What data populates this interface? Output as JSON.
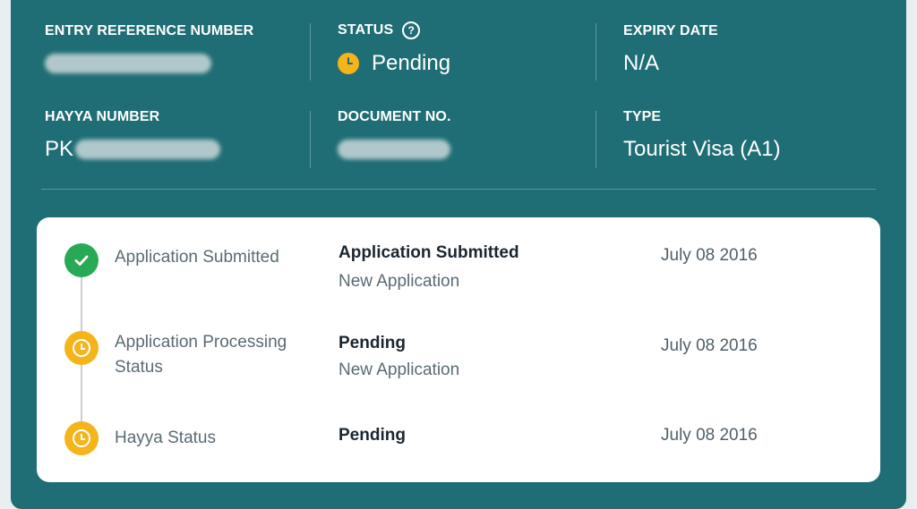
{
  "info": {
    "entry_ref_label": "ENTRY REFERENCE NUMBER",
    "status_label": "STATUS",
    "status_value": "Pending",
    "expiry_label": "EXPIRY DATE",
    "expiry_value": "N/A",
    "hayya_label": "HAYYA NUMBER",
    "hayya_value_prefix": "PK",
    "document_label": "DOCUMENT NO.",
    "type_label": "TYPE",
    "type_value": "Tourist Visa (A1)"
  },
  "timeline": [
    {
      "name": "Application Submitted",
      "status": "Application Submitted",
      "sub": "New Application",
      "date": "July 08 2016",
      "state": "done",
      "icon": "check-icon"
    },
    {
      "name_line1": "Application Processing",
      "name_line2": "Status",
      "status": "Pending",
      "sub": "New Application",
      "date": "July 08 2016",
      "state": "pending",
      "icon": "clock-icon"
    },
    {
      "name": "Hayya Status",
      "status": "Pending",
      "date": "July 08 2016",
      "state": "pending",
      "icon": "clock-icon"
    }
  ],
  "colors": {
    "card_bg": "#1f6e75",
    "done": "#27a955",
    "pending": "#f4b41a"
  }
}
